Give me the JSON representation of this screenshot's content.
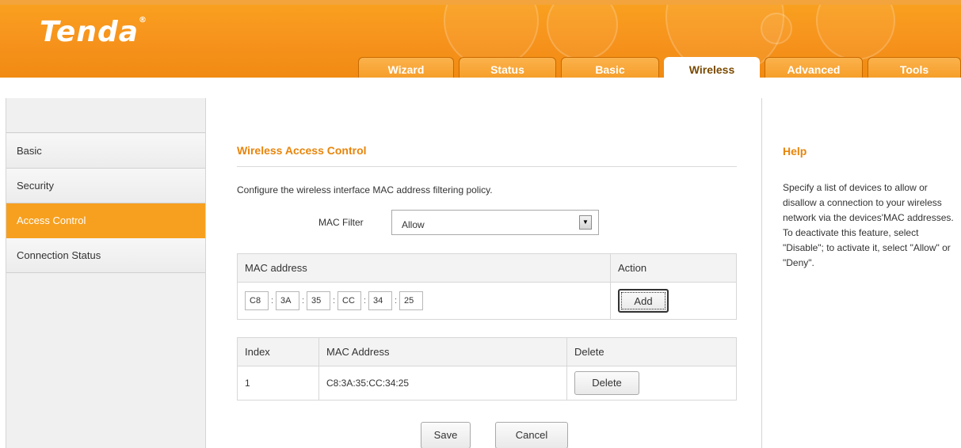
{
  "brand": {
    "logo_text": "Tenda",
    "registered_mark": "®"
  },
  "nav": {
    "tabs": [
      {
        "label": "Wizard",
        "active": false
      },
      {
        "label": "Status",
        "active": false
      },
      {
        "label": "Basic",
        "active": false
      },
      {
        "label": "Wireless",
        "active": true
      },
      {
        "label": "Advanced",
        "active": false
      },
      {
        "label": "Tools",
        "active": false
      }
    ]
  },
  "sidebar": {
    "items": [
      {
        "label": "Basic",
        "active": false
      },
      {
        "label": "Security",
        "active": false
      },
      {
        "label": "Access Control",
        "active": true
      },
      {
        "label": "Connection Status",
        "active": false
      }
    ]
  },
  "main": {
    "title": "Wireless Access Control",
    "description": "Configure the wireless interface MAC address filtering policy.",
    "mac_filter": {
      "label": "MAC Filter",
      "value": "Allow"
    },
    "mac_table": {
      "col_mac": "MAC address",
      "col_action": "Action",
      "mac_segments": [
        "C8",
        "3A",
        "35",
        "CC",
        "34",
        "25"
      ],
      "separator": ":",
      "add_label": "Add"
    },
    "list_table": {
      "headers": [
        "Index",
        "MAC Address",
        "Delete"
      ],
      "rows": [
        {
          "index": "1",
          "mac": "C8:3A:35:CC:34:25",
          "delete_label": "Delete"
        }
      ]
    },
    "save_label": "Save",
    "cancel_label": "Cancel"
  },
  "help": {
    "title": "Help",
    "text": "Specify a list of devices to allow or disallow a connection to your wireless network via the devices'MAC addresses. To deactivate this feature, select \"Disable\"; to activate it, select \"Allow\" or \"Deny\"."
  },
  "colors": {
    "brand_orange": "#f7941d",
    "accent_text": "#e8850c",
    "active_sidebar": "#f7a01f"
  }
}
